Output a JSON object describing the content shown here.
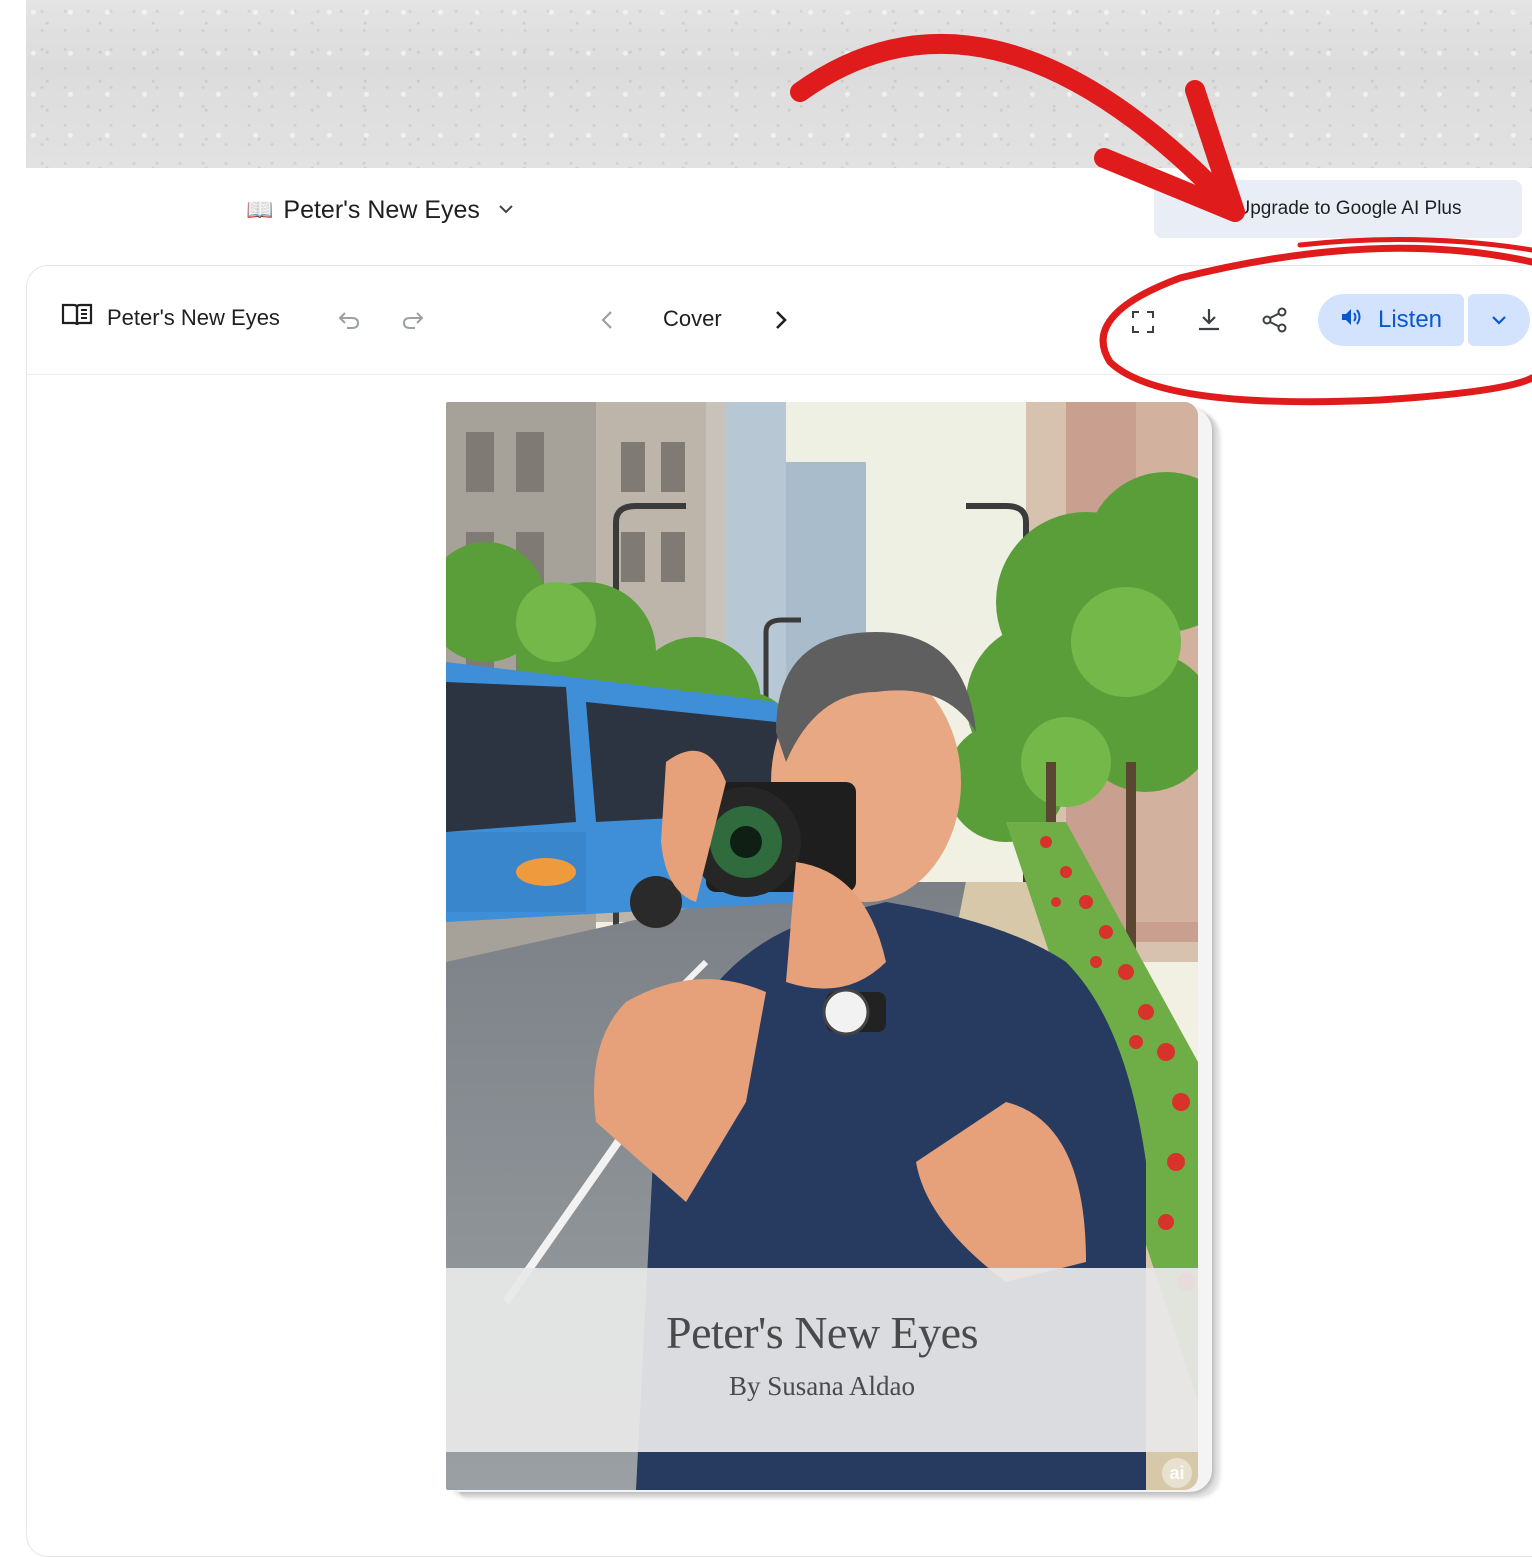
{
  "header": {
    "doc_emoji": "📖",
    "doc_title": "Peter's New Eyes",
    "upgrade_label": "Upgrade to Google AI Plus"
  },
  "toolbar": {
    "title": "Peter's New Eyes",
    "page_label": "Cover",
    "listen_label": "Listen"
  },
  "book": {
    "title": "Peter's New Eyes",
    "author": "By Susana Aldao",
    "badge": "ai"
  },
  "colors": {
    "annotation_red": "#e01b1b",
    "listen_bg": "#d3e3fd",
    "listen_fg": "#0b57d0",
    "upgrade_bg": "#e9eef6"
  }
}
